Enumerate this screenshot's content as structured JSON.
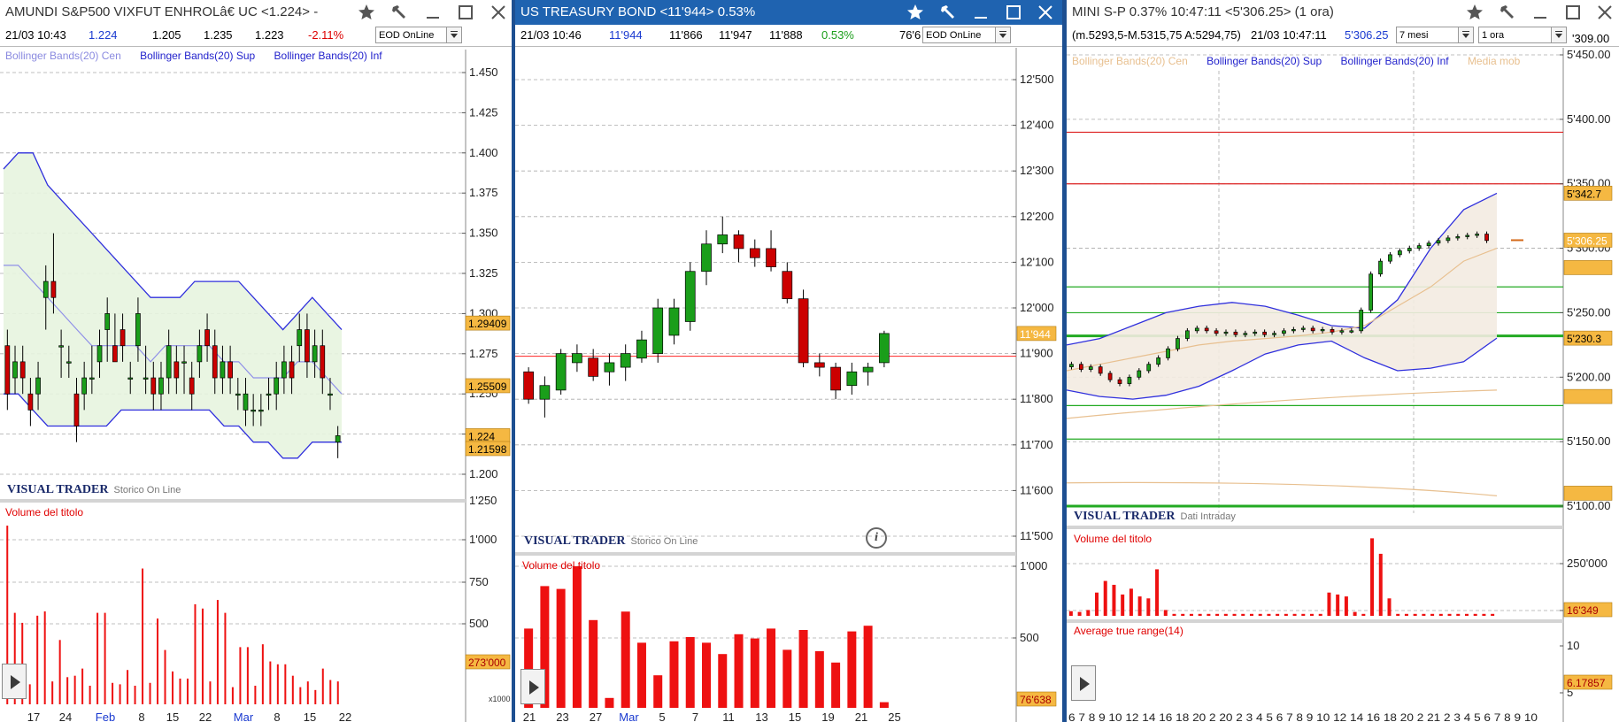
{
  "w1": {
    "title": "AMUNDI S&P500 VIXFUT ENHROLâ€ UC <1.224> -",
    "info": [
      "21/03 10:43",
      "1.224",
      "1.205",
      "1.235",
      "1.223",
      "-2.11%"
    ],
    "feed": "EOD OnLine",
    "legend": [
      "Bollinger Bands(20) Cen",
      "Bollinger Bands(20) Sup",
      "Bollinger Bands(20) Inf"
    ],
    "price_ticks": [
      "1.450",
      "1.425",
      "1.400",
      "1.375",
      "1.350",
      "1.325",
      "1.300",
      "1.275",
      "1.250",
      "1.225",
      "1.200"
    ],
    "price_labels": [
      "1.29409",
      "1.25509",
      "1.224",
      "1.21598"
    ],
    "brand": "VISUAL TRADER",
    "brand_sub": "Storico On Line",
    "volume_title": "Volume del titolo",
    "volume_ticks": [
      "1'250",
      "1'000",
      "750",
      "500"
    ],
    "volume_label": "273'000",
    "volume_mult": "x1000",
    "x_ticks": [
      "17",
      "24",
      "Feb",
      "8",
      "15",
      "22",
      "Mar",
      "8",
      "15",
      "22"
    ]
  },
  "w2": {
    "title": "US TREASURY BOND <11'944> 0.53%",
    "info": [
      "21/03 10:46",
      "11'944",
      "11'866",
      "11'947",
      "11'888",
      "0.53%",
      "76'6"
    ],
    "feed": "EOD OnLine",
    "price_ticks": [
      "12'500",
      "12'400",
      "12'300",
      "12'200",
      "12'100",
      "12'000",
      "11'900",
      "11'800",
      "11'700",
      "11'600",
      "11'500"
    ],
    "price_label": "11'944",
    "brand": "VISUAL TRADER",
    "brand_sub": "Storico On Line",
    "volume_title": "Volume del titolo",
    "volume_ticks": [
      "1'000",
      "500"
    ],
    "volume_label": "76'638",
    "x_ticks": [
      "21",
      "23",
      "27",
      "Mar",
      "5",
      "7",
      "11",
      "13",
      "15",
      "19",
      "21",
      "25"
    ],
    "info_icon": "i"
  },
  "w3": {
    "title": "MINI S-P 0.37% 10:47:11 <5'306.25> (1 ora)",
    "info": [
      "(m.5293,5-M.5315,75 A:5294,75)",
      "21/03 10:47:11",
      "5'306.25"
    ],
    "period": "7 mesi",
    "interval": "1 ora",
    "legend": [
      "Bollinger Bands(20) Cen",
      "Bollinger Bands(20) Sup",
      "Bollinger Bands(20) Inf",
      "Media mob"
    ],
    "price_ticks": [
      "5'450.00",
      "5'400.00",
      "5'350.00",
      "5'300.00",
      "5'250.00",
      "5'200.00",
      "5'150.00",
      "5'100.00"
    ],
    "top_partial": "'309.00",
    "price_labels": [
      "5'342.7",
      "5'306.25",
      "5'230.3"
    ],
    "brand": "VISUAL TRADER",
    "brand_sub": "Dati Intraday",
    "volume_title": "Volume del titolo",
    "volume_ticks": [
      "250'000",
      "5"
    ],
    "volume_label": "16'349",
    "atr_title": "Average true range(14)",
    "atr_ticks": [
      "10",
      "5"
    ],
    "atr_label": "6.17857",
    "x_ticks": "6 7 8 9 10  12 14 16 18 20  2 20 2 3 4 5 6 7 8 9 10  12 14 16 18 20 2 21 2 3 4 5 6 7 8 9 10"
  },
  "colors": {
    "up": "#1a9e1a",
    "down": "#cc0000",
    "band": "#3030dd",
    "center": "#9090e8",
    "volume": "#ee1111",
    "titlebar_active": "#1f63b0",
    "titlebar_inactive": "#ffffff",
    "label_bg": "#f5b842"
  },
  "chart_data": [
    {
      "type": "candlestick",
      "name": "AMUNDI S&P500 VIXFUT",
      "ylim": [
        1.2,
        1.45
      ],
      "candles": [
        [
          1.28,
          1.29,
          1.24,
          1.25
        ],
        [
          1.26,
          1.28,
          1.25,
          1.27
        ],
        [
          1.27,
          1.28,
          1.25,
          1.26
        ],
        [
          1.25,
          1.26,
          1.23,
          1.24
        ],
        [
          1.25,
          1.27,
          1.24,
          1.26
        ],
        [
          1.31,
          1.33,
          1.29,
          1.32
        ],
        [
          1.32,
          1.35,
          1.3,
          1.31
        ],
        [
          1.28,
          1.29,
          1.26,
          1.28
        ],
        [
          1.27,
          1.28,
          1.26,
          1.27
        ],
        [
          1.25,
          1.26,
          1.22,
          1.23
        ],
        [
          1.25,
          1.27,
          1.24,
          1.26
        ],
        [
          1.26,
          1.28,
          1.25,
          1.26
        ],
        [
          1.27,
          1.29,
          1.26,
          1.28
        ],
        [
          1.29,
          1.31,
          1.27,
          1.3
        ],
        [
          1.28,
          1.3,
          1.27,
          1.27
        ],
        [
          1.29,
          1.3,
          1.27,
          1.28
        ],
        [
          1.26,
          1.27,
          1.25,
          1.26
        ],
        [
          1.28,
          1.31,
          1.27,
          1.3
        ],
        [
          1.26,
          1.28,
          1.25,
          1.26
        ],
        [
          1.26,
          1.27,
          1.24,
          1.25
        ],
        [
          1.25,
          1.27,
          1.24,
          1.26
        ],
        [
          1.26,
          1.29,
          1.25,
          1.28
        ],
        [
          1.27,
          1.28,
          1.25,
          1.26
        ],
        [
          1.27,
          1.28,
          1.25,
          1.27
        ],
        [
          1.26,
          1.27,
          1.24,
          1.25
        ],
        [
          1.27,
          1.29,
          1.26,
          1.28
        ],
        [
          1.29,
          1.3,
          1.27,
          1.28
        ],
        [
          1.28,
          1.29,
          1.25,
          1.26
        ],
        [
          1.26,
          1.28,
          1.25,
          1.27
        ],
        [
          1.27,
          1.28,
          1.25,
          1.26
        ],
        [
          1.25,
          1.26,
          1.24,
          1.25
        ],
        [
          1.24,
          1.26,
          1.23,
          1.25
        ],
        [
          1.24,
          1.25,
          1.23,
          1.24
        ],
        [
          1.24,
          1.25,
          1.23,
          1.24
        ],
        [
          1.25,
          1.26,
          1.24,
          1.25
        ],
        [
          1.25,
          1.27,
          1.24,
          1.26
        ],
        [
          1.26,
          1.28,
          1.25,
          1.27
        ],
        [
          1.27,
          1.28,
          1.25,
          1.26
        ],
        [
          1.28,
          1.3,
          1.27,
          1.29
        ],
        [
          1.29,
          1.3,
          1.26,
          1.27
        ],
        [
          1.27,
          1.29,
          1.26,
          1.28
        ],
        [
          1.28,
          1.29,
          1.25,
          1.26
        ],
        [
          1.25,
          1.26,
          1.24,
          1.25
        ],
        [
          1.22,
          1.23,
          1.21,
          1.224
        ]
      ],
      "bb_upper": [
        1.39,
        1.4,
        1.4,
        1.38,
        1.37,
        1.36,
        1.35,
        1.34,
        1.33,
        1.32,
        1.31,
        1.31,
        1.31,
        1.32,
        1.32,
        1.32,
        1.32,
        1.31,
        1.3,
        1.29,
        1.3,
        1.31,
        1.3,
        1.29
      ],
      "bb_center": [
        1.33,
        1.33,
        1.32,
        1.31,
        1.3,
        1.29,
        1.28,
        1.28,
        1.28,
        1.28,
        1.27,
        1.28,
        1.28,
        1.28,
        1.28,
        1.27,
        1.27,
        1.26,
        1.26,
        1.26,
        1.27,
        1.27,
        1.26,
        1.25
      ],
      "bb_lower": [
        1.25,
        1.25,
        1.24,
        1.23,
        1.23,
        1.23,
        1.23,
        1.23,
        1.24,
        1.24,
        1.24,
        1.24,
        1.24,
        1.24,
        1.24,
        1.23,
        1.23,
        1.22,
        1.22,
        1.21,
        1.21,
        1.22,
        1.22,
        1.22
      ],
      "volume": [
        1250,
        640,
        570,
        140,
        620,
        650,
        160,
        450,
        190,
        200,
        250,
        130,
        640,
        640,
        150,
        140,
        240,
        130,
        950,
        150,
        600,
        380,
        230,
        180,
        180,
        700,
        670,
        160,
        730,
        640,
        120,
        400,
        400,
        130,
        420,
        300,
        280,
        280,
        200,
        120,
        160,
        100,
        250,
        170,
        160
      ],
      "volume_ylim": [
        0,
        1300
      ]
    },
    {
      "type": "candlestick",
      "name": "US TREASURY BOND",
      "ylim": [
        11500,
        12500
      ],
      "candles": [
        [
          11860,
          11870,
          11790,
          11800
        ],
        [
          11800,
          11850,
          11760,
          11830
        ],
        [
          11820,
          11910,
          11810,
          11900
        ],
        [
          11880,
          11920,
          11860,
          11900
        ],
        [
          11890,
          11910,
          11840,
          11850
        ],
        [
          11860,
          11900,
          11830,
          11880
        ],
        [
          11870,
          11920,
          11840,
          11900
        ],
        [
          11890,
          11950,
          11880,
          11930
        ],
        [
          11900,
          12020,
          11880,
          12000
        ],
        [
          11940,
          12020,
          11920,
          12000
        ],
        [
          11970,
          12100,
          11950,
          12080
        ],
        [
          12080,
          12170,
          12050,
          12140
        ],
        [
          12140,
          12200,
          12120,
          12160
        ],
        [
          12160,
          12170,
          12100,
          12130
        ],
        [
          12130,
          12150,
          12090,
          12110
        ],
        [
          12130,
          12170,
          12080,
          12090
        ],
        [
          12080,
          12100,
          12010,
          12020
        ],
        [
          12020,
          12040,
          11870,
          11880
        ],
        [
          11880,
          11900,
          11850,
          11870
        ],
        [
          11870,
          11880,
          11800,
          11820
        ],
        [
          11830,
          11880,
          11810,
          11860
        ],
        [
          11860,
          11880,
          11830,
          11870
        ],
        [
          11880,
          11950,
          11870,
          11944
        ]
      ],
      "volume": [
        560,
        860,
        840,
        1000,
        620,
        70,
        680,
        460,
        230,
        470,
        500,
        460,
        380,
        520,
        490,
        560,
        410,
        550,
        400,
        320,
        540,
        580,
        40
      ],
      "volume_ylim": [
        0,
        1000
      ]
    },
    {
      "type": "candlestick",
      "name": "MINI S-P",
      "ylim": [
        5100,
        5450
      ],
      "bb_upper": [
        5225,
        5230,
        5240,
        5250,
        5255,
        5258,
        5255,
        5248,
        5240,
        5238,
        5260,
        5300,
        5330,
        5342.7
      ],
      "bb_center": [
        5205,
        5210,
        5215,
        5220,
        5225,
        5228,
        5230,
        5232,
        5235,
        5240,
        5255,
        5270,
        5290,
        5300
      ],
      "bb_lower": [
        5190,
        5185,
        5183,
        5186,
        5193,
        5205,
        5218,
        5225,
        5228,
        5215,
        5205,
        5207,
        5212,
        5230.3
      ],
      "hlines": [
        {
          "y": 5390,
          "color": "#dd2222"
        },
        {
          "y": 5350,
          "color": "#dd2222"
        },
        {
          "y": 5270,
          "color": "#22aa22"
        },
        {
          "y": 5250,
          "color": "#22aa22"
        },
        {
          "y": 5232,
          "color": "#22aa22",
          "width": 3
        },
        {
          "y": 5178,
          "color": "#22aa22"
        },
        {
          "y": 5152,
          "color": "#22aa22"
        },
        {
          "y": 5100,
          "color": "#22aa22",
          "width": 3
        }
      ],
      "volume": [
        12,
        10,
        15,
        60,
        90,
        80,
        55,
        70,
        50,
        45,
        120,
        15,
        5,
        5,
        5,
        5,
        5,
        5,
        5,
        5,
        5,
        5,
        5,
        5,
        5,
        5,
        5,
        5,
        5,
        5,
        60,
        55,
        50,
        10,
        5,
        200,
        160,
        45,
        5,
        5,
        5,
        5,
        5,
        5,
        5,
        5,
        5,
        5,
        5,
        5
      ],
      "volume_ylim": [
        0,
        210
      ],
      "price_last": 5306.25
    }
  ]
}
